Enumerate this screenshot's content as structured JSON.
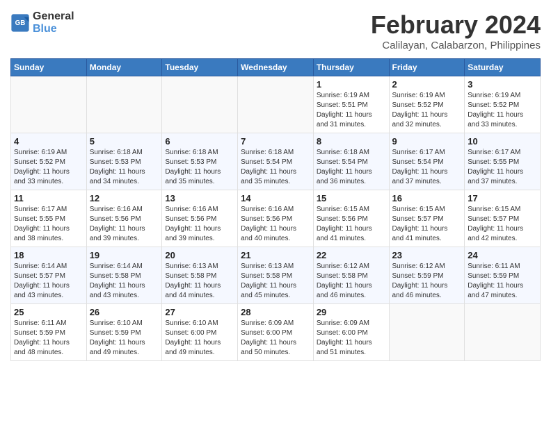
{
  "logo": {
    "line1": "General",
    "line2": "Blue"
  },
  "title": "February 2024",
  "subtitle": "Calilayan, Calabarzon, Philippines",
  "days_header": [
    "Sunday",
    "Monday",
    "Tuesday",
    "Wednesday",
    "Thursday",
    "Friday",
    "Saturday"
  ],
  "weeks": [
    [
      {
        "day": "",
        "info": ""
      },
      {
        "day": "",
        "info": ""
      },
      {
        "day": "",
        "info": ""
      },
      {
        "day": "",
        "info": ""
      },
      {
        "day": "1",
        "info": "Sunrise: 6:19 AM\nSunset: 5:51 PM\nDaylight: 11 hours\nand 31 minutes."
      },
      {
        "day": "2",
        "info": "Sunrise: 6:19 AM\nSunset: 5:52 PM\nDaylight: 11 hours\nand 32 minutes."
      },
      {
        "day": "3",
        "info": "Sunrise: 6:19 AM\nSunset: 5:52 PM\nDaylight: 11 hours\nand 33 minutes."
      }
    ],
    [
      {
        "day": "4",
        "info": "Sunrise: 6:19 AM\nSunset: 5:52 PM\nDaylight: 11 hours\nand 33 minutes."
      },
      {
        "day": "5",
        "info": "Sunrise: 6:18 AM\nSunset: 5:53 PM\nDaylight: 11 hours\nand 34 minutes."
      },
      {
        "day": "6",
        "info": "Sunrise: 6:18 AM\nSunset: 5:53 PM\nDaylight: 11 hours\nand 35 minutes."
      },
      {
        "day": "7",
        "info": "Sunrise: 6:18 AM\nSunset: 5:54 PM\nDaylight: 11 hours\nand 35 minutes."
      },
      {
        "day": "8",
        "info": "Sunrise: 6:18 AM\nSunset: 5:54 PM\nDaylight: 11 hours\nand 36 minutes."
      },
      {
        "day": "9",
        "info": "Sunrise: 6:17 AM\nSunset: 5:54 PM\nDaylight: 11 hours\nand 37 minutes."
      },
      {
        "day": "10",
        "info": "Sunrise: 6:17 AM\nSunset: 5:55 PM\nDaylight: 11 hours\nand 37 minutes."
      }
    ],
    [
      {
        "day": "11",
        "info": "Sunrise: 6:17 AM\nSunset: 5:55 PM\nDaylight: 11 hours\nand 38 minutes."
      },
      {
        "day": "12",
        "info": "Sunrise: 6:16 AM\nSunset: 5:56 PM\nDaylight: 11 hours\nand 39 minutes."
      },
      {
        "day": "13",
        "info": "Sunrise: 6:16 AM\nSunset: 5:56 PM\nDaylight: 11 hours\nand 39 minutes."
      },
      {
        "day": "14",
        "info": "Sunrise: 6:16 AM\nSunset: 5:56 PM\nDaylight: 11 hours\nand 40 minutes."
      },
      {
        "day": "15",
        "info": "Sunrise: 6:15 AM\nSunset: 5:56 PM\nDaylight: 11 hours\nand 41 minutes."
      },
      {
        "day": "16",
        "info": "Sunrise: 6:15 AM\nSunset: 5:57 PM\nDaylight: 11 hours\nand 41 minutes."
      },
      {
        "day": "17",
        "info": "Sunrise: 6:15 AM\nSunset: 5:57 PM\nDaylight: 11 hours\nand 42 minutes."
      }
    ],
    [
      {
        "day": "18",
        "info": "Sunrise: 6:14 AM\nSunset: 5:57 PM\nDaylight: 11 hours\nand 43 minutes."
      },
      {
        "day": "19",
        "info": "Sunrise: 6:14 AM\nSunset: 5:58 PM\nDaylight: 11 hours\nand 43 minutes."
      },
      {
        "day": "20",
        "info": "Sunrise: 6:13 AM\nSunset: 5:58 PM\nDaylight: 11 hours\nand 44 minutes."
      },
      {
        "day": "21",
        "info": "Sunrise: 6:13 AM\nSunset: 5:58 PM\nDaylight: 11 hours\nand 45 minutes."
      },
      {
        "day": "22",
        "info": "Sunrise: 6:12 AM\nSunset: 5:58 PM\nDaylight: 11 hours\nand 46 minutes."
      },
      {
        "day": "23",
        "info": "Sunrise: 6:12 AM\nSunset: 5:59 PM\nDaylight: 11 hours\nand 46 minutes."
      },
      {
        "day": "24",
        "info": "Sunrise: 6:11 AM\nSunset: 5:59 PM\nDaylight: 11 hours\nand 47 minutes."
      }
    ],
    [
      {
        "day": "25",
        "info": "Sunrise: 6:11 AM\nSunset: 5:59 PM\nDaylight: 11 hours\nand 48 minutes."
      },
      {
        "day": "26",
        "info": "Sunrise: 6:10 AM\nSunset: 5:59 PM\nDaylight: 11 hours\nand 49 minutes."
      },
      {
        "day": "27",
        "info": "Sunrise: 6:10 AM\nSunset: 6:00 PM\nDaylight: 11 hours\nand 49 minutes."
      },
      {
        "day": "28",
        "info": "Sunrise: 6:09 AM\nSunset: 6:00 PM\nDaylight: 11 hours\nand 50 minutes."
      },
      {
        "day": "29",
        "info": "Sunrise: 6:09 AM\nSunset: 6:00 PM\nDaylight: 11 hours\nand 51 minutes."
      },
      {
        "day": "",
        "info": ""
      },
      {
        "day": "",
        "info": ""
      }
    ]
  ]
}
